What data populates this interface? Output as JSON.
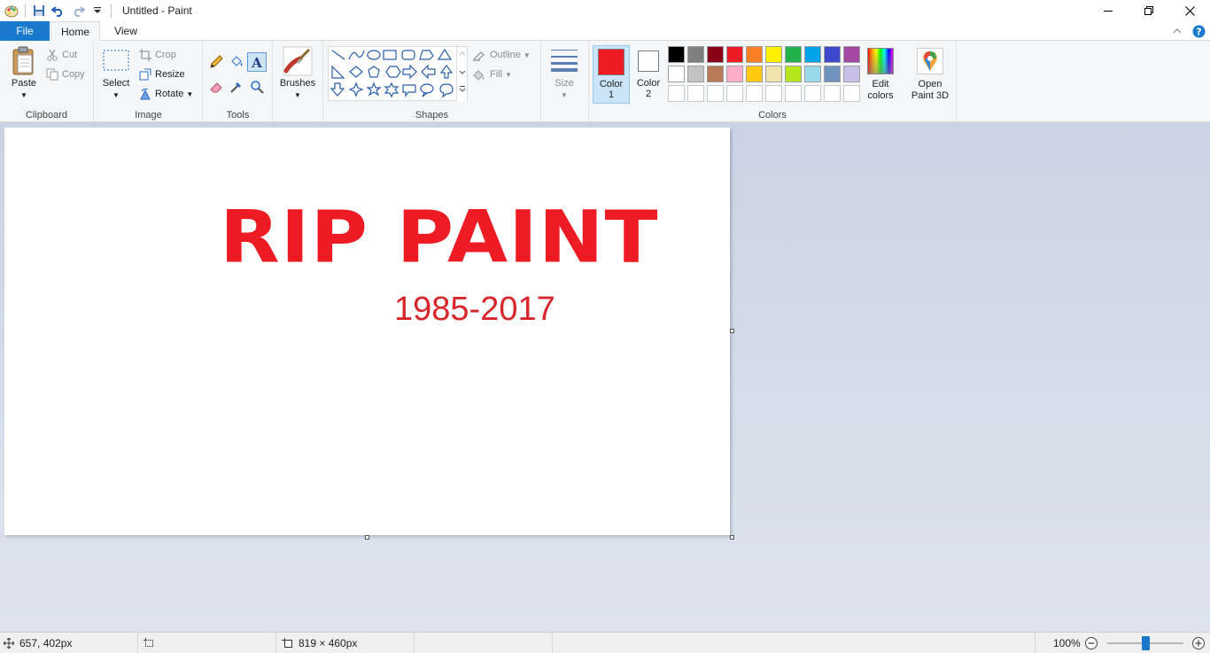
{
  "window": {
    "title": "Untitled - Paint"
  },
  "tabs": {
    "file": "File",
    "home": "Home",
    "view": "View"
  },
  "clipboard": {
    "paste": "Paste",
    "cut": "Cut",
    "copy": "Copy",
    "label": "Clipboard"
  },
  "image": {
    "select": "Select",
    "crop": "Crop",
    "resize": "Resize",
    "rotate": "Rotate",
    "label": "Image"
  },
  "tools": {
    "label": "Tools"
  },
  "brushes": {
    "label": "Brushes"
  },
  "shapes": {
    "outline": "Outline",
    "fill": "Fill",
    "label": "Shapes"
  },
  "size": {
    "label": "Size"
  },
  "colors": {
    "color1_line1": "Color",
    "color1_line2": "1",
    "color2_line1": "Color",
    "color2_line2": "2",
    "edit_line1": "Edit",
    "edit_line2": "colors",
    "label": "Colors",
    "color1_value": "#ed1c24",
    "color2_value": "#ffffff",
    "palette_row1": [
      "#000000",
      "#7f7f7f",
      "#880015",
      "#ed1c24",
      "#ff7f27",
      "#fff200",
      "#22b14c",
      "#00a2e8",
      "#3f48cc",
      "#a349a4"
    ],
    "palette_row2": [
      "#ffffff",
      "#c3c3c3",
      "#b97a57",
      "#ffaec9",
      "#ffc90e",
      "#efe4b0",
      "#b5e61d",
      "#99d9ea",
      "#7092be",
      "#c8bfe7"
    ],
    "palette_row3": [
      "#ffffff",
      "#ffffff",
      "#ffffff",
      "#ffffff",
      "#ffffff",
      "#ffffff",
      "#ffffff",
      "#ffffff",
      "#ffffff",
      "#ffffff"
    ]
  },
  "paint3d": {
    "line1": "Open",
    "line2": "Paint 3D"
  },
  "canvas": {
    "headline": "RIP PAINT",
    "years": "1985-2017"
  },
  "status": {
    "cursor_pos": "657, 402px",
    "selection_size": "",
    "image_size": "819 × 460px",
    "zoom": "100%"
  }
}
